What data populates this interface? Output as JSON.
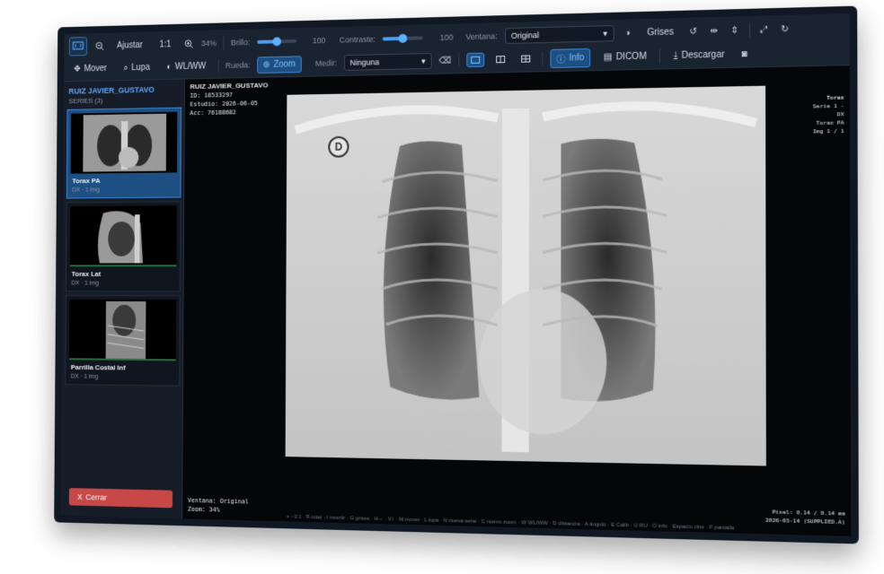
{
  "toolbar": {
    "zoom_out_label": "",
    "fit_label": "Ajustar",
    "one_to_one_label": "1:1",
    "zoom_value": "34%",
    "brightness_label": "Brillo:",
    "brightness_value": "100",
    "brightness_level": 0.5,
    "contrast_label": "Contraste:",
    "contrast_value": "100",
    "contrast_level": 0.5,
    "window_label": "Ventana:",
    "window_value": "Original",
    "grayscale_label": "Grises",
    "move_label": "Mover",
    "magnifier_label": "Lupa",
    "wlww_label": "WL/WW",
    "wheel_label": "Rueda:",
    "wheel_zoom_label": "Zoom",
    "measure_label": "Medir:",
    "measure_value": "Ninguna",
    "info_label": "Info",
    "dicom_label": "DICOM",
    "download_label": "Descargar"
  },
  "sidebar": {
    "patient_name": "RUIZ JAVIER_GUSTAVO",
    "series_count": "SERIES (3)",
    "series": [
      {
        "title": "Torax PA",
        "meta": "DX · 1 img"
      },
      {
        "title": "Torax Lat",
        "meta": "DX · 1 img"
      },
      {
        "title": "Parrilla Costal Inf",
        "meta": "DX · 1 img"
      }
    ],
    "close_label": "Cerrar",
    "close_icon_glyph": "X"
  },
  "viewer": {
    "top_left": {
      "name": "RUIZ JAVIER_GUSTAVO",
      "id": "ID: 18533297",
      "study": "Estudio: 2026-06-05",
      "acc": "Acc: 76188682"
    },
    "top_right": {
      "title": "Torax",
      "series": "Serie 1 -",
      "modality": "DX",
      "description": "Torax PA",
      "image": "Img 1 / 1"
    },
    "bottom_left": {
      "window": "Ventana: Original",
      "zoom": "Zoom: 34%"
    },
    "bottom_right": {
      "pixel": "Pixel: 0.14 / 0.14 mm",
      "date": "2026-03-14 (SUPPLIED.A)"
    },
    "marker": "D",
    "hint": "+ - 0 1 · R rotar · I invertir · G grises · H↔ · V↕ · M mover · L lupa · N nueva serie · C nuevo zoom · W WL/WW · D distancia · A ángulo · E Calib · U RU · O info · Espacio cine · F pantalla"
  },
  "colors": {
    "accent": "#3e86d6",
    "accent_text": "#5fa7ff",
    "close_button": "#c84747"
  }
}
